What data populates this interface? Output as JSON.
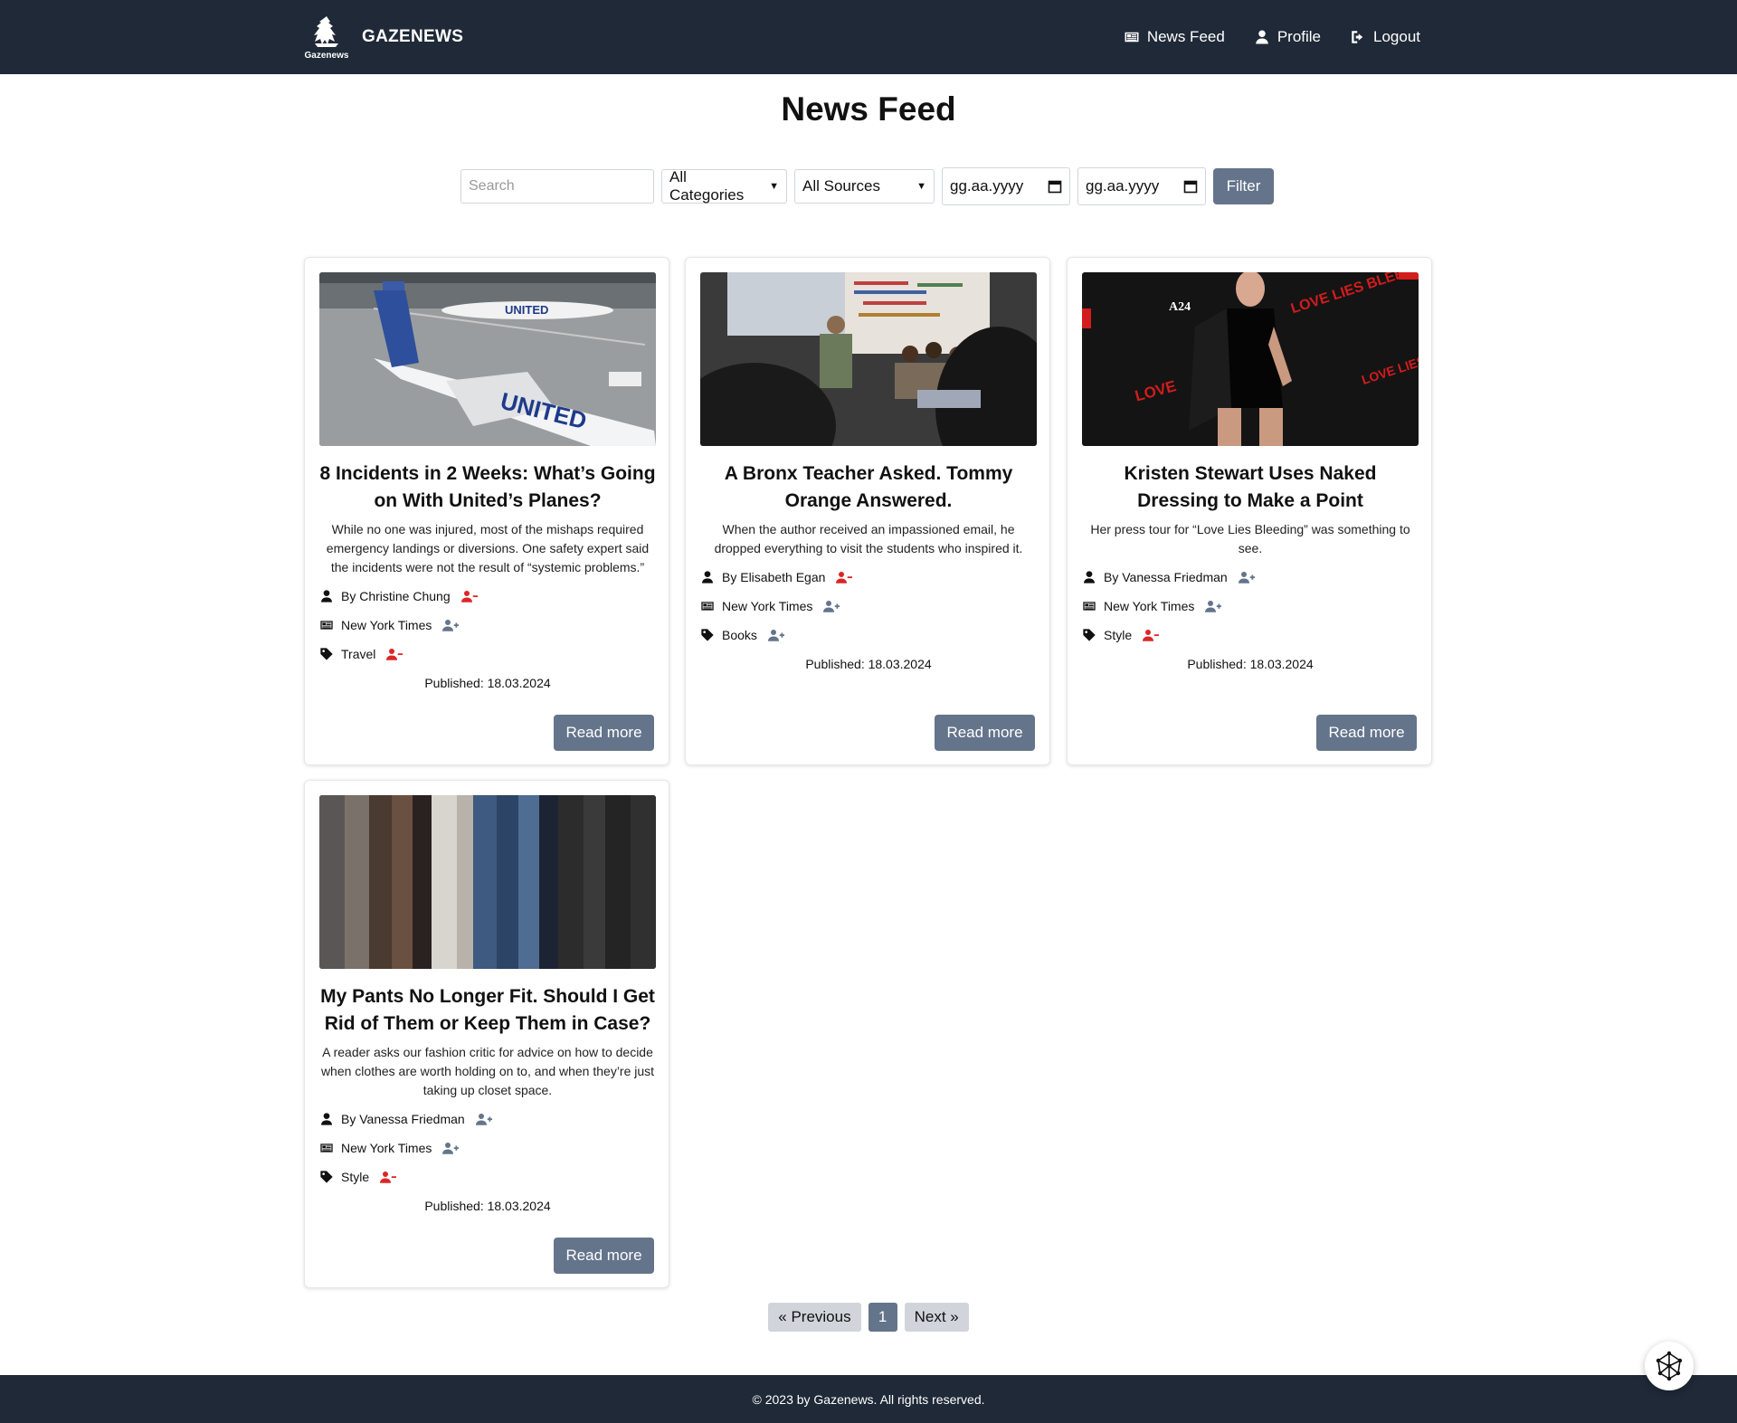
{
  "header": {
    "brand": "GAZENEWS",
    "logo_caption": "Gazenews",
    "nav": [
      {
        "label": "News Feed",
        "icon": "newspaper-icon"
      },
      {
        "label": "Profile",
        "icon": "user-icon"
      },
      {
        "label": "Logout",
        "icon": "logout-icon"
      }
    ]
  },
  "main": {
    "title": "News Feed",
    "filters": {
      "search_placeholder": "Search",
      "category": "All Categories",
      "source": "All Sources",
      "date_from": "gg.aa.yyyy",
      "date_to": "gg.aa.yyyy",
      "filter_label": "Filter"
    },
    "articles": [
      {
        "title": "8 Incidents in 2 Weeks: What’s Going on With United’s Planes?",
        "description": "While no one was injured, most of the mishaps required emergency landings or diversions. One safety expert said the incidents were not the result of “systemic problems.”",
        "author": "By Christine Chung",
        "author_action": "unfollow",
        "source": "New York Times",
        "source_action": "follow",
        "category": "Travel",
        "category_action": "unfollow",
        "published": "Published: 18.03.2024",
        "read_more": "Read more"
      },
      {
        "title": "A Bronx Teacher Asked. Tommy Orange Answered.",
        "description": "When the author received an impassioned email, he dropped everything to visit the students who inspired it.",
        "author": "By Elisabeth Egan",
        "author_action": "unfollow",
        "source": "New York Times",
        "source_action": "follow",
        "category": "Books",
        "category_action": "follow",
        "published": "Published: 18.03.2024",
        "read_more": "Read more"
      },
      {
        "title": "Kristen Stewart Uses Naked Dressing to Make a Point",
        "description": "Her press tour for “Love Lies Bleeding” was something to see.",
        "author": "By Vanessa Friedman",
        "author_action": "follow",
        "source": "New York Times",
        "source_action": "follow",
        "category": "Style",
        "category_action": "unfollow",
        "published": "Published: 18.03.2024",
        "read_more": "Read more"
      },
      {
        "title": "My Pants No Longer Fit. Should I Get Rid of Them or Keep Them in Case?",
        "description": "A reader asks our fashion critic for advice on how to decide when clothes are worth holding on to, and when they’re just taking up closet space.",
        "author": "By Vanessa Friedman",
        "author_action": "follow",
        "source": "New York Times",
        "source_action": "follow",
        "category": "Style",
        "category_action": "unfollow",
        "published": "Published: 18.03.2024",
        "read_more": "Read more"
      }
    ],
    "pagination": {
      "previous": "« Previous",
      "current": "1",
      "next": "Next »"
    }
  },
  "footer": {
    "text": "© 2023 by Gazenews. All rights reserved."
  },
  "colors": {
    "header_bg": "#1f2937",
    "button": "#64748b",
    "unfollow": "#dc2626",
    "follow": "#64748b"
  }
}
